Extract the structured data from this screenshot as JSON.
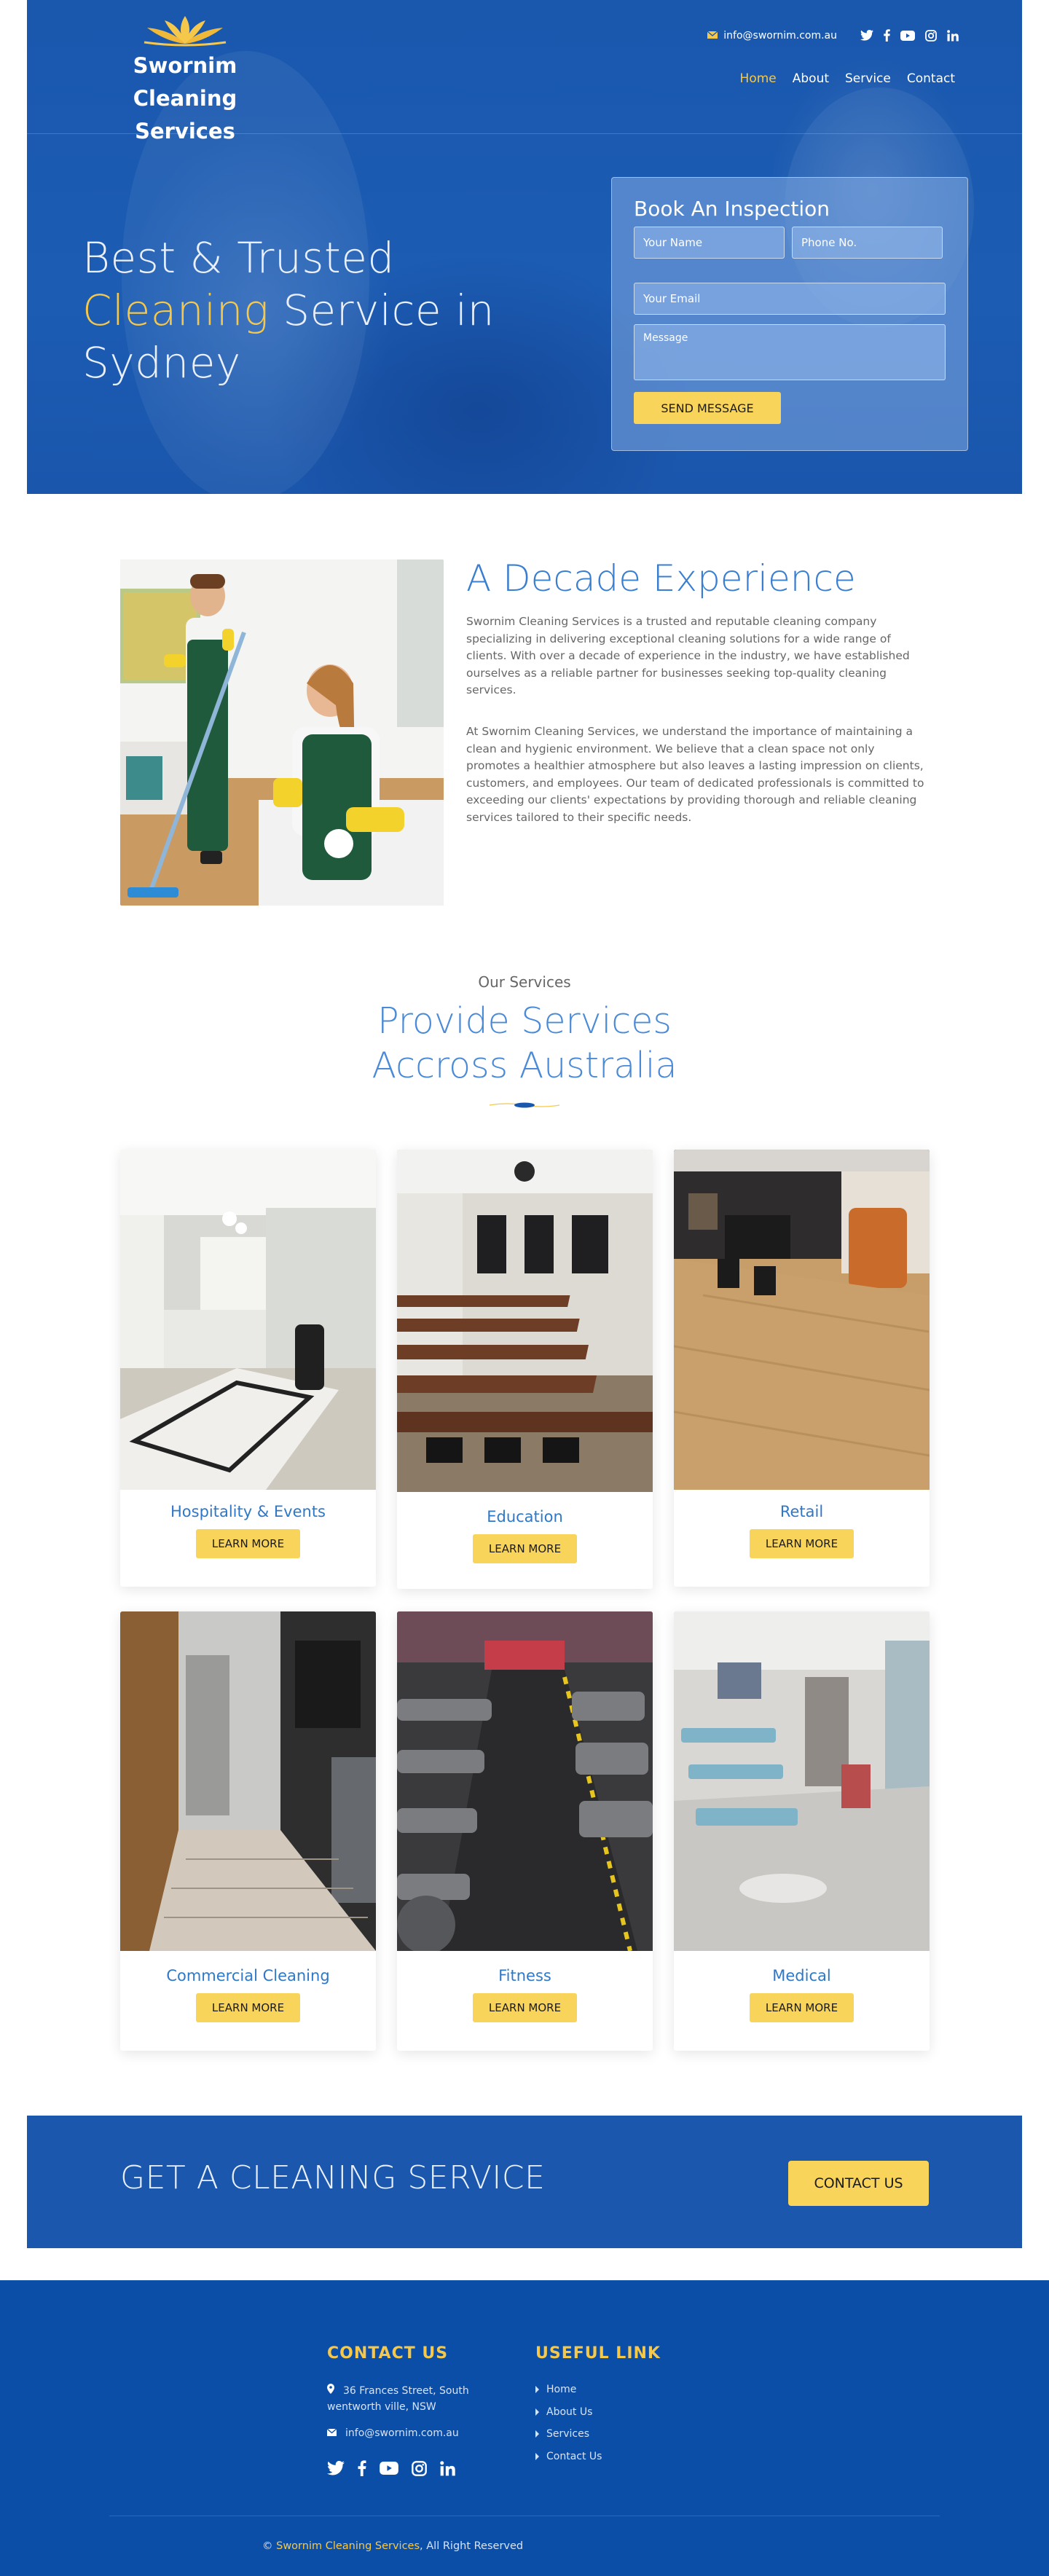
{
  "header": {
    "logo_line1": "Swornim Cleaning",
    "logo_line2": "Services",
    "email": "info@swornim.com.au",
    "social_icons": [
      "twitter-icon",
      "facebook-icon",
      "youtube-icon",
      "instagram-icon",
      "linkedin-icon"
    ],
    "nav": [
      {
        "label": "Home",
        "active": true
      },
      {
        "label": "About",
        "active": false
      },
      {
        "label": "Service",
        "active": false
      },
      {
        "label": "Contact",
        "active": false
      }
    ]
  },
  "hero": {
    "title_part1": "Best & Trusted",
    "title_highlight": "Cleaning",
    "title_part2": "Service in",
    "title_part3": "Sydney"
  },
  "booking_form": {
    "title": "Book An Inspection",
    "name_placeholder": "Your Name",
    "phone_placeholder": "Phone No.",
    "email_placeholder": "Your Email",
    "message_placeholder": "Message",
    "submit_label": "SEND MESSAGE"
  },
  "about": {
    "title": "A Decade Experience",
    "paragraph1": "Swornim Cleaning Services is a trusted and reputable cleaning company specializing in delivering exceptional cleaning solutions for a wide range of clients. With over a decade of experience in the industry, we have established ourselves as a reliable partner for businesses seeking top-quality cleaning services.",
    "paragraph2": "At Swornim Cleaning Services, we understand the importance of maintaining a clean and hygienic environment. We believe that a clean space not only promotes a healthier atmosphere but also leaves a lasting impression on clients, customers, and employees. Our team of dedicated professionals is committed to exceeding our clients' expectations by providing thorough and reliable cleaning services tailored to their specific needs."
  },
  "services": {
    "kicker": "Our Services",
    "title_line1": "Provide Services",
    "title_line2": "Accross Australia",
    "items": [
      {
        "name": "Hospitality & Events",
        "button": "LEARN MORE"
      },
      {
        "name": "Education",
        "button": "LEARN MORE"
      },
      {
        "name": "Retail",
        "button": "LEARN MORE"
      },
      {
        "name": "Commercial Cleaning",
        "button": "LEARN MORE"
      },
      {
        "name": "Fitness",
        "button": "LEARN MORE"
      },
      {
        "name": "Medical",
        "button": "LEARN MORE"
      }
    ]
  },
  "cta": {
    "title": "GET A CLEANING SERVICE",
    "button": "CONTACT US"
  },
  "footer": {
    "contact_heading": "CONTACT US",
    "address_line1": "36 Frances Street, South",
    "address_line2": "wentworth ville, NSW",
    "email": "info@swornim.com.au",
    "useful_heading": "USEFUL LINK",
    "links": [
      "Home",
      "About Us",
      "Services",
      "Contact Us"
    ],
    "copyright_prefix": "©",
    "copyright_brand": "Swornim Cleaning Services",
    "copyright_suffix": ", All Right Reserved"
  },
  "colors": {
    "brand_blue": "#1957ad",
    "accent_yellow": "#f9d45a",
    "heading_blue": "#3a7ed0",
    "footer_blue": "#0b4ea8"
  }
}
